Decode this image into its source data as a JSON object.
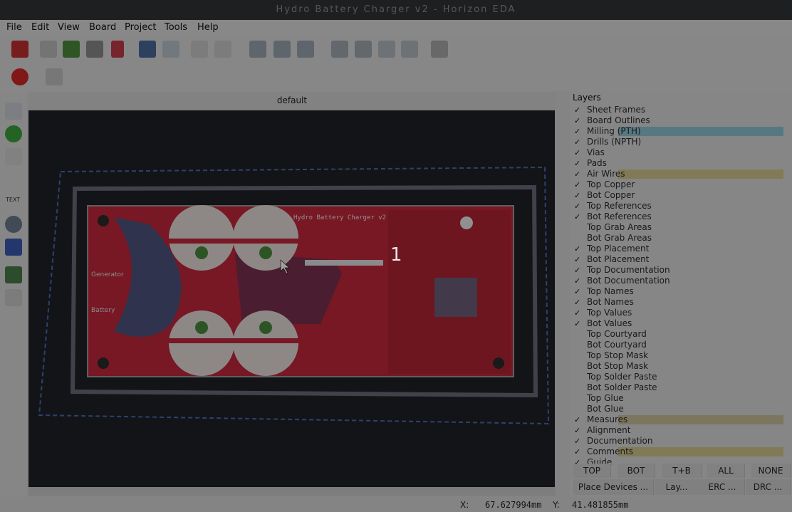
{
  "window": {
    "title": "Hydro Battery Charger v2 - Horizon EDA"
  },
  "menu": [
    "File",
    "Edit",
    "View",
    "Board",
    "Project",
    "Tools",
    "Help"
  ],
  "document": {
    "title": "default"
  },
  "board": {
    "label": "Hydro Battery Charger v2",
    "left_labels": [
      "Generator",
      "Battery"
    ],
    "step_number": "1"
  },
  "left_tools": {
    "text_label": "TEXT"
  },
  "layers_panel": {
    "title": "Layers",
    "items": [
      {
        "name": "Sheet Frames",
        "checked": true,
        "color": ""
      },
      {
        "name": "Board Outlines",
        "checked": true,
        "color": ""
      },
      {
        "name": "Milling (PTH)",
        "checked": true,
        "color": "#4ab0c8"
      },
      {
        "name": "Drills (NPTH)",
        "checked": true,
        "color": ""
      },
      {
        "name": "Vias",
        "checked": true,
        "color": ""
      },
      {
        "name": "Pads",
        "checked": true,
        "color": ""
      },
      {
        "name": "Air Wires",
        "checked": true,
        "color": "#c8b44a"
      },
      {
        "name": "Top Copper",
        "checked": true,
        "color": ""
      },
      {
        "name": "Bot Copper",
        "checked": true,
        "color": ""
      },
      {
        "name": "Top References",
        "checked": true,
        "color": ""
      },
      {
        "name": "Bot References",
        "checked": true,
        "color": ""
      },
      {
        "name": "Top Grab Areas",
        "checked": false,
        "color": ""
      },
      {
        "name": "Bot Grab Areas",
        "checked": false,
        "color": ""
      },
      {
        "name": "Top Placement",
        "checked": true,
        "color": ""
      },
      {
        "name": "Bot Placement",
        "checked": true,
        "color": ""
      },
      {
        "name": "Top Documentation",
        "checked": true,
        "color": ""
      },
      {
        "name": "Bot Documentation",
        "checked": true,
        "color": ""
      },
      {
        "name": "Top Names",
        "checked": true,
        "color": ""
      },
      {
        "name": "Bot Names",
        "checked": true,
        "color": ""
      },
      {
        "name": "Top Values",
        "checked": true,
        "color": ""
      },
      {
        "name": "Bot Values",
        "checked": true,
        "color": ""
      },
      {
        "name": "Top Courtyard",
        "checked": false,
        "color": ""
      },
      {
        "name": "Bot Courtyard",
        "checked": false,
        "color": ""
      },
      {
        "name": "Top Stop Mask",
        "checked": false,
        "color": ""
      },
      {
        "name": "Bot Stop Mask",
        "checked": false,
        "color": ""
      },
      {
        "name": "Top Solder Paste",
        "checked": false,
        "color": ""
      },
      {
        "name": "Bot Solder Paste",
        "checked": false,
        "color": ""
      },
      {
        "name": "Top Glue",
        "checked": false,
        "color": ""
      },
      {
        "name": "Bot Glue",
        "checked": false,
        "color": ""
      },
      {
        "name": "Measures",
        "checked": true,
        "color": "#b8a860"
      },
      {
        "name": "Alignment",
        "checked": true,
        "color": ""
      },
      {
        "name": "Documentation",
        "checked": true,
        "color": ""
      },
      {
        "name": "Comments",
        "checked": true,
        "color": "#c8b44a"
      },
      {
        "name": "Guide",
        "checked": true,
        "color": ""
      }
    ],
    "buttons": [
      "TOP",
      "BOT",
      "T+B",
      "ALL",
      "NONE"
    ]
  },
  "bottom_tabs": [
    "Place Devices ...",
    "Lay...",
    "ERC ...",
    "DRC ..."
  ],
  "status": {
    "x_label": "X:",
    "x_value": "67.627994mm",
    "y_label": "Y:",
    "y_value": "41.481855mm"
  },
  "colors": {
    "board_red": "#c0283a",
    "canvas_bg": "#1f2126",
    "copper_blue": "#3a5a8a",
    "pad_green": "#4a8a3a"
  }
}
